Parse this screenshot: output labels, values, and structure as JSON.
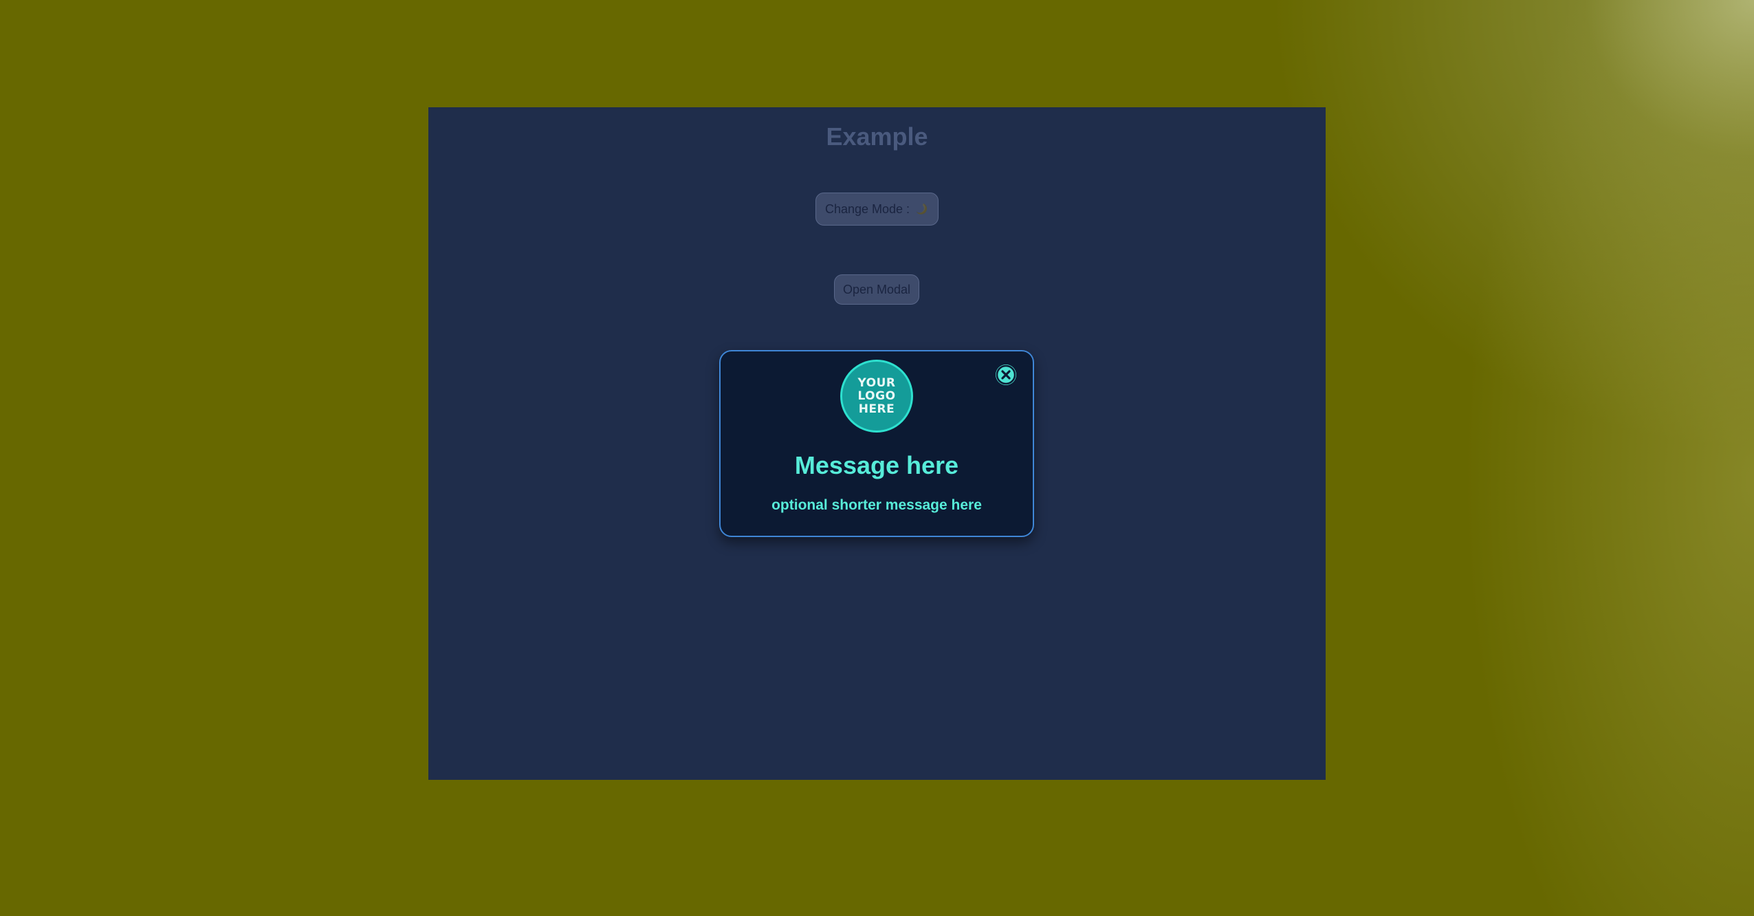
{
  "page": {
    "title": "Example",
    "change_mode_label": "Change Mode :",
    "change_mode_icon": "moon-icon",
    "open_modal_label": "Open Modal"
  },
  "modal": {
    "logo_lines": [
      "YOUR",
      "LOGO",
      "HERE"
    ],
    "message": "Message here",
    "submessage": "optional shorter message here",
    "close_icon": "close-icon"
  },
  "colors": {
    "desktop": "#676800",
    "page_background": "#1f2d4b",
    "modal_background": "#0c1a33",
    "modal_border": "#3f86d6",
    "accent": "#57ecd9",
    "logo_fill": "#149c99"
  }
}
